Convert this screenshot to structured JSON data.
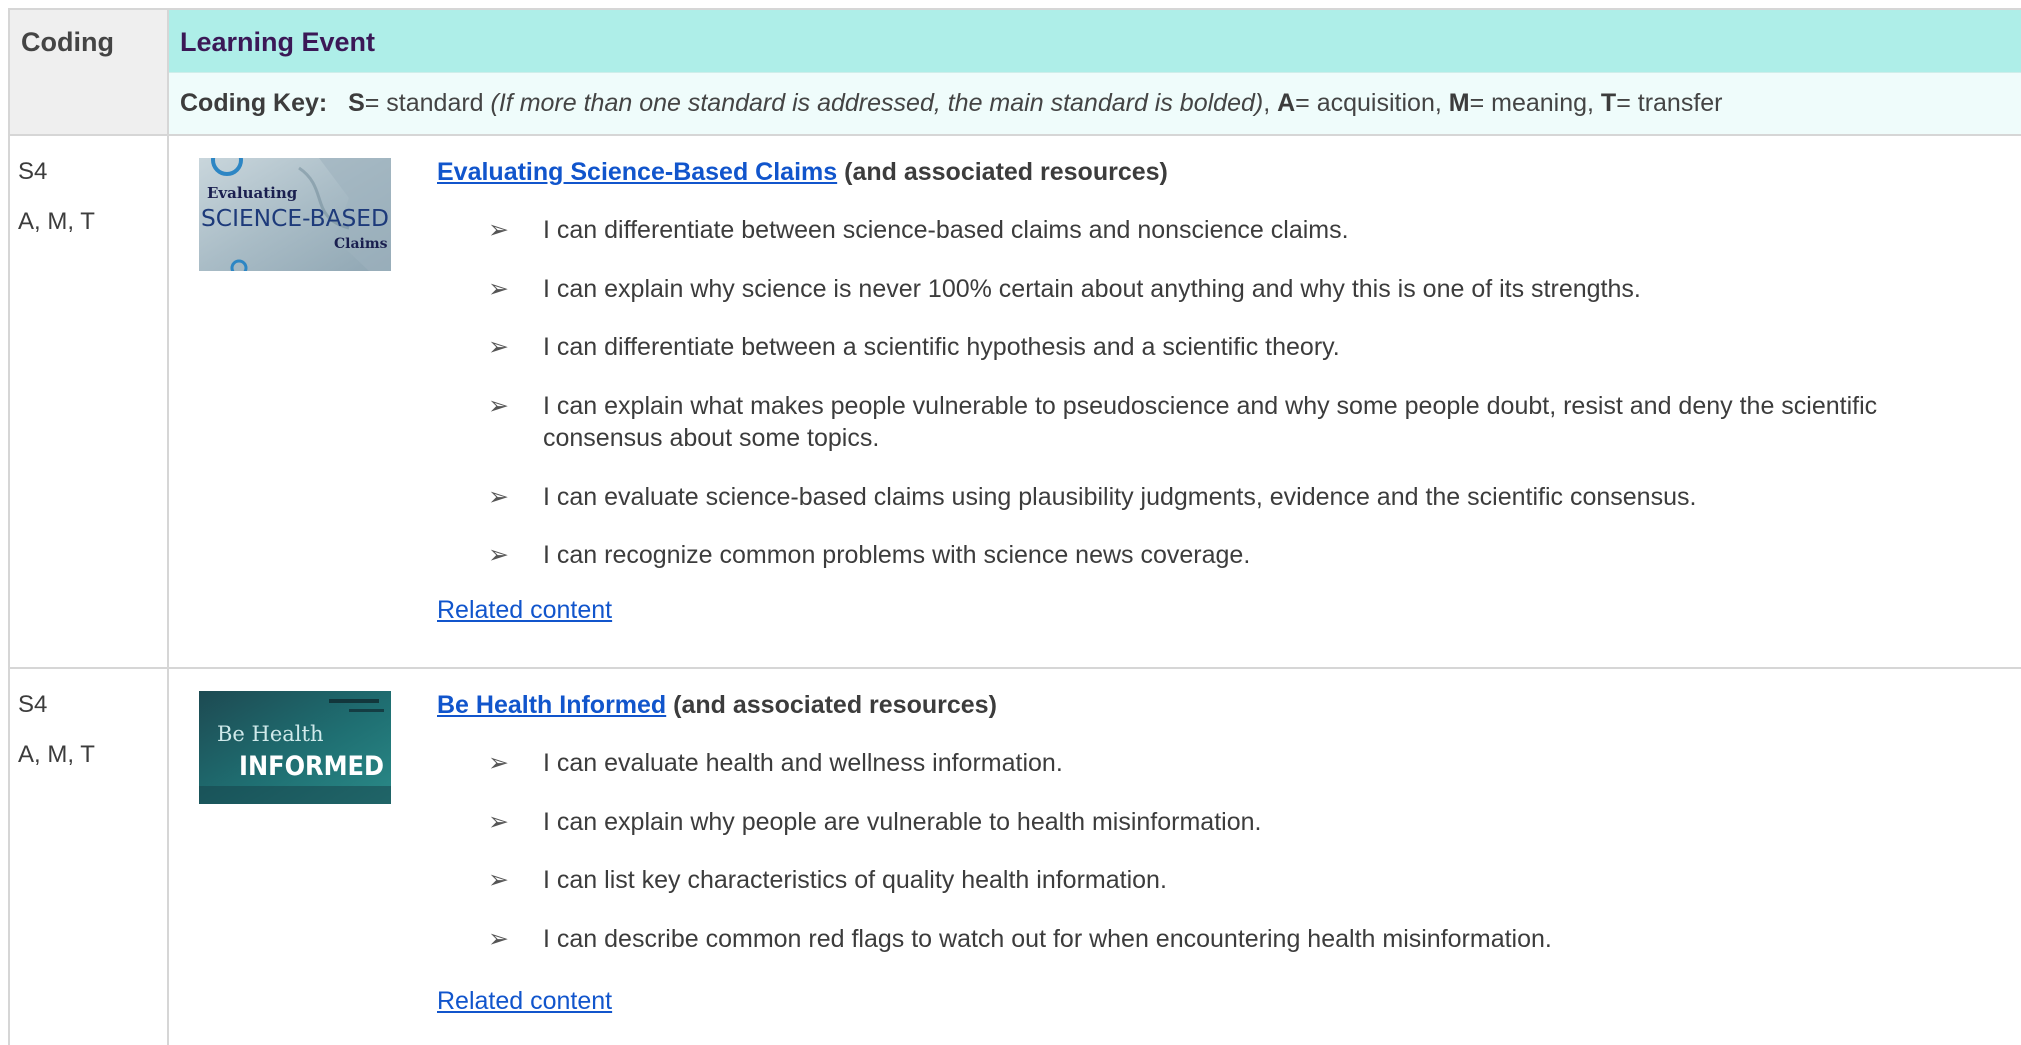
{
  "header": {
    "coding_label": "Coding",
    "event_label": "Learning Event",
    "key": {
      "prefix": "Coding Key:",
      "s_letter": "S",
      "s_text": "= standard ",
      "s_note": "(If more than one standard is addressed, the main standard is bolded)",
      "sep1": ",  ",
      "a_letter": "A",
      "a_text": "= acquisition,  ",
      "m_letter": "M",
      "m_text": "= meaning,  ",
      "t_letter": "T",
      "t_text": "= transfer"
    }
  },
  "events": [
    {
      "standard": "S4",
      "codes": "A, M, T",
      "thumbnail": {
        "line1": "Evaluating",
        "line2": "SCIENCE-BASED",
        "line3": "Claims"
      },
      "title_link": "Evaluating Science-Based Claims",
      "title_suffix": " (and associated resources)",
      "objectives": [
        "I can differentiate between science-based claims and nonscience claims.",
        "I can explain why science is never 100% certain about anything and why this is one of its strengths.",
        "I can differentiate between a scientific hypothesis and a scientific theory.",
        "I can explain what makes people vulnerable to pseudoscience and why some people doubt, resist and deny the scientific consensus about some topics.",
        "I can evaluate science-based claims using plausibility judgments, evidence and the scientific consensus.",
        "I can recognize common problems with science news coverage."
      ],
      "related": "Related content"
    },
    {
      "standard": "S4",
      "codes": "A, M, T",
      "thumbnail": {
        "line1": "Be Health",
        "line2": "INFORMED"
      },
      "title_link": "Be Health Informed",
      "title_suffix": " (and associated resources)",
      "objectives": [
        "I can evaluate health and wellness information.",
        "I can explain why people are vulnerable to health misinformation.",
        "I can list key characteristics of quality health information.",
        "I can describe common red flags to watch out for when encountering health misinformation."
      ],
      "related": "Related content"
    }
  ],
  "bullet_glyph": "➢",
  "colors": {
    "header_teal": "#aeeee8",
    "key_row_bg": "#effcfb",
    "coding_header_bg": "#efefef",
    "link_blue": "#1155cc",
    "event_title_purple": "#3b1856"
  }
}
